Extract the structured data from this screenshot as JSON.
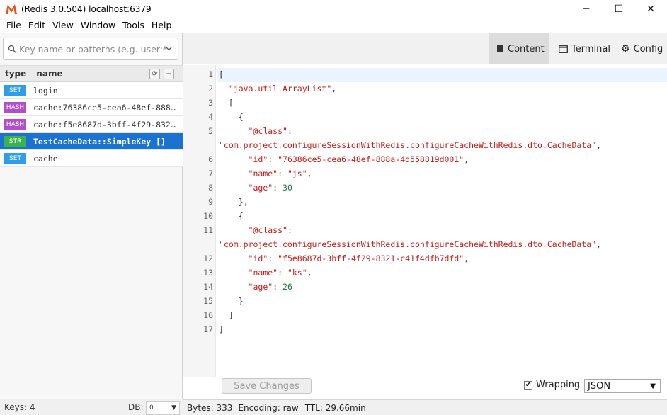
{
  "window": {
    "title": "(Redis 3.0.504) localhost:6379",
    "minimize": "─",
    "maximize": "☐",
    "close": "✕"
  },
  "menu": [
    "File",
    "Edit",
    "View",
    "Window",
    "Tools",
    "Help"
  ],
  "search": {
    "placeholder": "Key name or patterns (e.g. user:*)"
  },
  "keys_header": {
    "type": "type",
    "name": "name",
    "refresh": "⟳",
    "add": "+"
  },
  "keys": [
    {
      "type": "SET",
      "name": "login",
      "color": "#2f9ee8"
    },
    {
      "type": "HASH",
      "name": "cache:76386ce5-cea6-48ef-888a-…",
      "color": "#b04fc7"
    },
    {
      "type": "HASH",
      "name": "cache:f5e8687d-3bff-4f29-8321-…",
      "color": "#b04fc7"
    },
    {
      "type": "STR",
      "name": "TestCacheData::SimpleKey []",
      "color": "#3cb34a"
    },
    {
      "type": "SET",
      "name": "cache",
      "color": "#2f9ee8"
    }
  ],
  "status_left": {
    "keys": "Keys: 4",
    "db_label": "DB:",
    "db_value": "0"
  },
  "tabs": [
    {
      "label": "Content",
      "icon": "book-icon"
    },
    {
      "label": "Terminal",
      "icon": "terminal-icon"
    },
    {
      "label": "Config",
      "icon": "gear-icon"
    }
  ],
  "editor": {
    "lines": [
      {
        "num": "1",
        "html": "["
      },
      {
        "num": "2",
        "html": "  <span class=\"s\">\"java.util.ArrayList\"</span>,"
      },
      {
        "num": "3",
        "html": "  ["
      },
      {
        "num": "4",
        "html": "    {"
      },
      {
        "num": "5",
        "html": "      <span class=\"k\">\"@class\"</span>:"
      },
      {
        "num": "",
        "html": "<span class=\"s\">\"com.project.configureSessionWithRedis.configureCacheWithRedis.dto.CacheData\"</span>,"
      },
      {
        "num": "6",
        "html": "      <span class=\"k\">\"id\"</span>: <span class=\"s\">\"76386ce5-cea6-48ef-888a-4d558819d001\"</span>,"
      },
      {
        "num": "7",
        "html": "      <span class=\"k\">\"name\"</span>: <span class=\"s\">\"js\"</span>,"
      },
      {
        "num": "8",
        "html": "      <span class=\"k\">\"age\"</span>: <span class=\"n\">30</span>"
      },
      {
        "num": "9",
        "html": "    },"
      },
      {
        "num": "10",
        "html": "    {"
      },
      {
        "num": "11",
        "html": "      <span class=\"k\">\"@class\"</span>:"
      },
      {
        "num": "",
        "html": "<span class=\"s\">\"com.project.configureSessionWithRedis.configureCacheWithRedis.dto.CacheData\"</span>,"
      },
      {
        "num": "12",
        "html": "      <span class=\"k\">\"id\"</span>: <span class=\"s\">\"f5e8687d-3bff-4f29-8321-c41f4dfb7dfd\"</span>,"
      },
      {
        "num": "13",
        "html": "      <span class=\"k\">\"name\"</span>: <span class=\"s\">\"ks\"</span>,"
      },
      {
        "num": "14",
        "html": "      <span class=\"k\">\"age\"</span>: <span class=\"n\">26</span>"
      },
      {
        "num": "15",
        "html": "    }"
      },
      {
        "num": "16",
        "html": "  ]"
      },
      {
        "num": "17",
        "html": "]"
      }
    ]
  },
  "bottom": {
    "save_label": "Save Changes",
    "wrapping_label": "Wrapping",
    "wrapping_checked": "✔",
    "format_value": "JSON",
    "format_arrow": "▼"
  },
  "status_right": {
    "bytes": "Bytes: 333",
    "encoding": "Encoding: raw",
    "ttl": "TTL: 29.66min"
  }
}
